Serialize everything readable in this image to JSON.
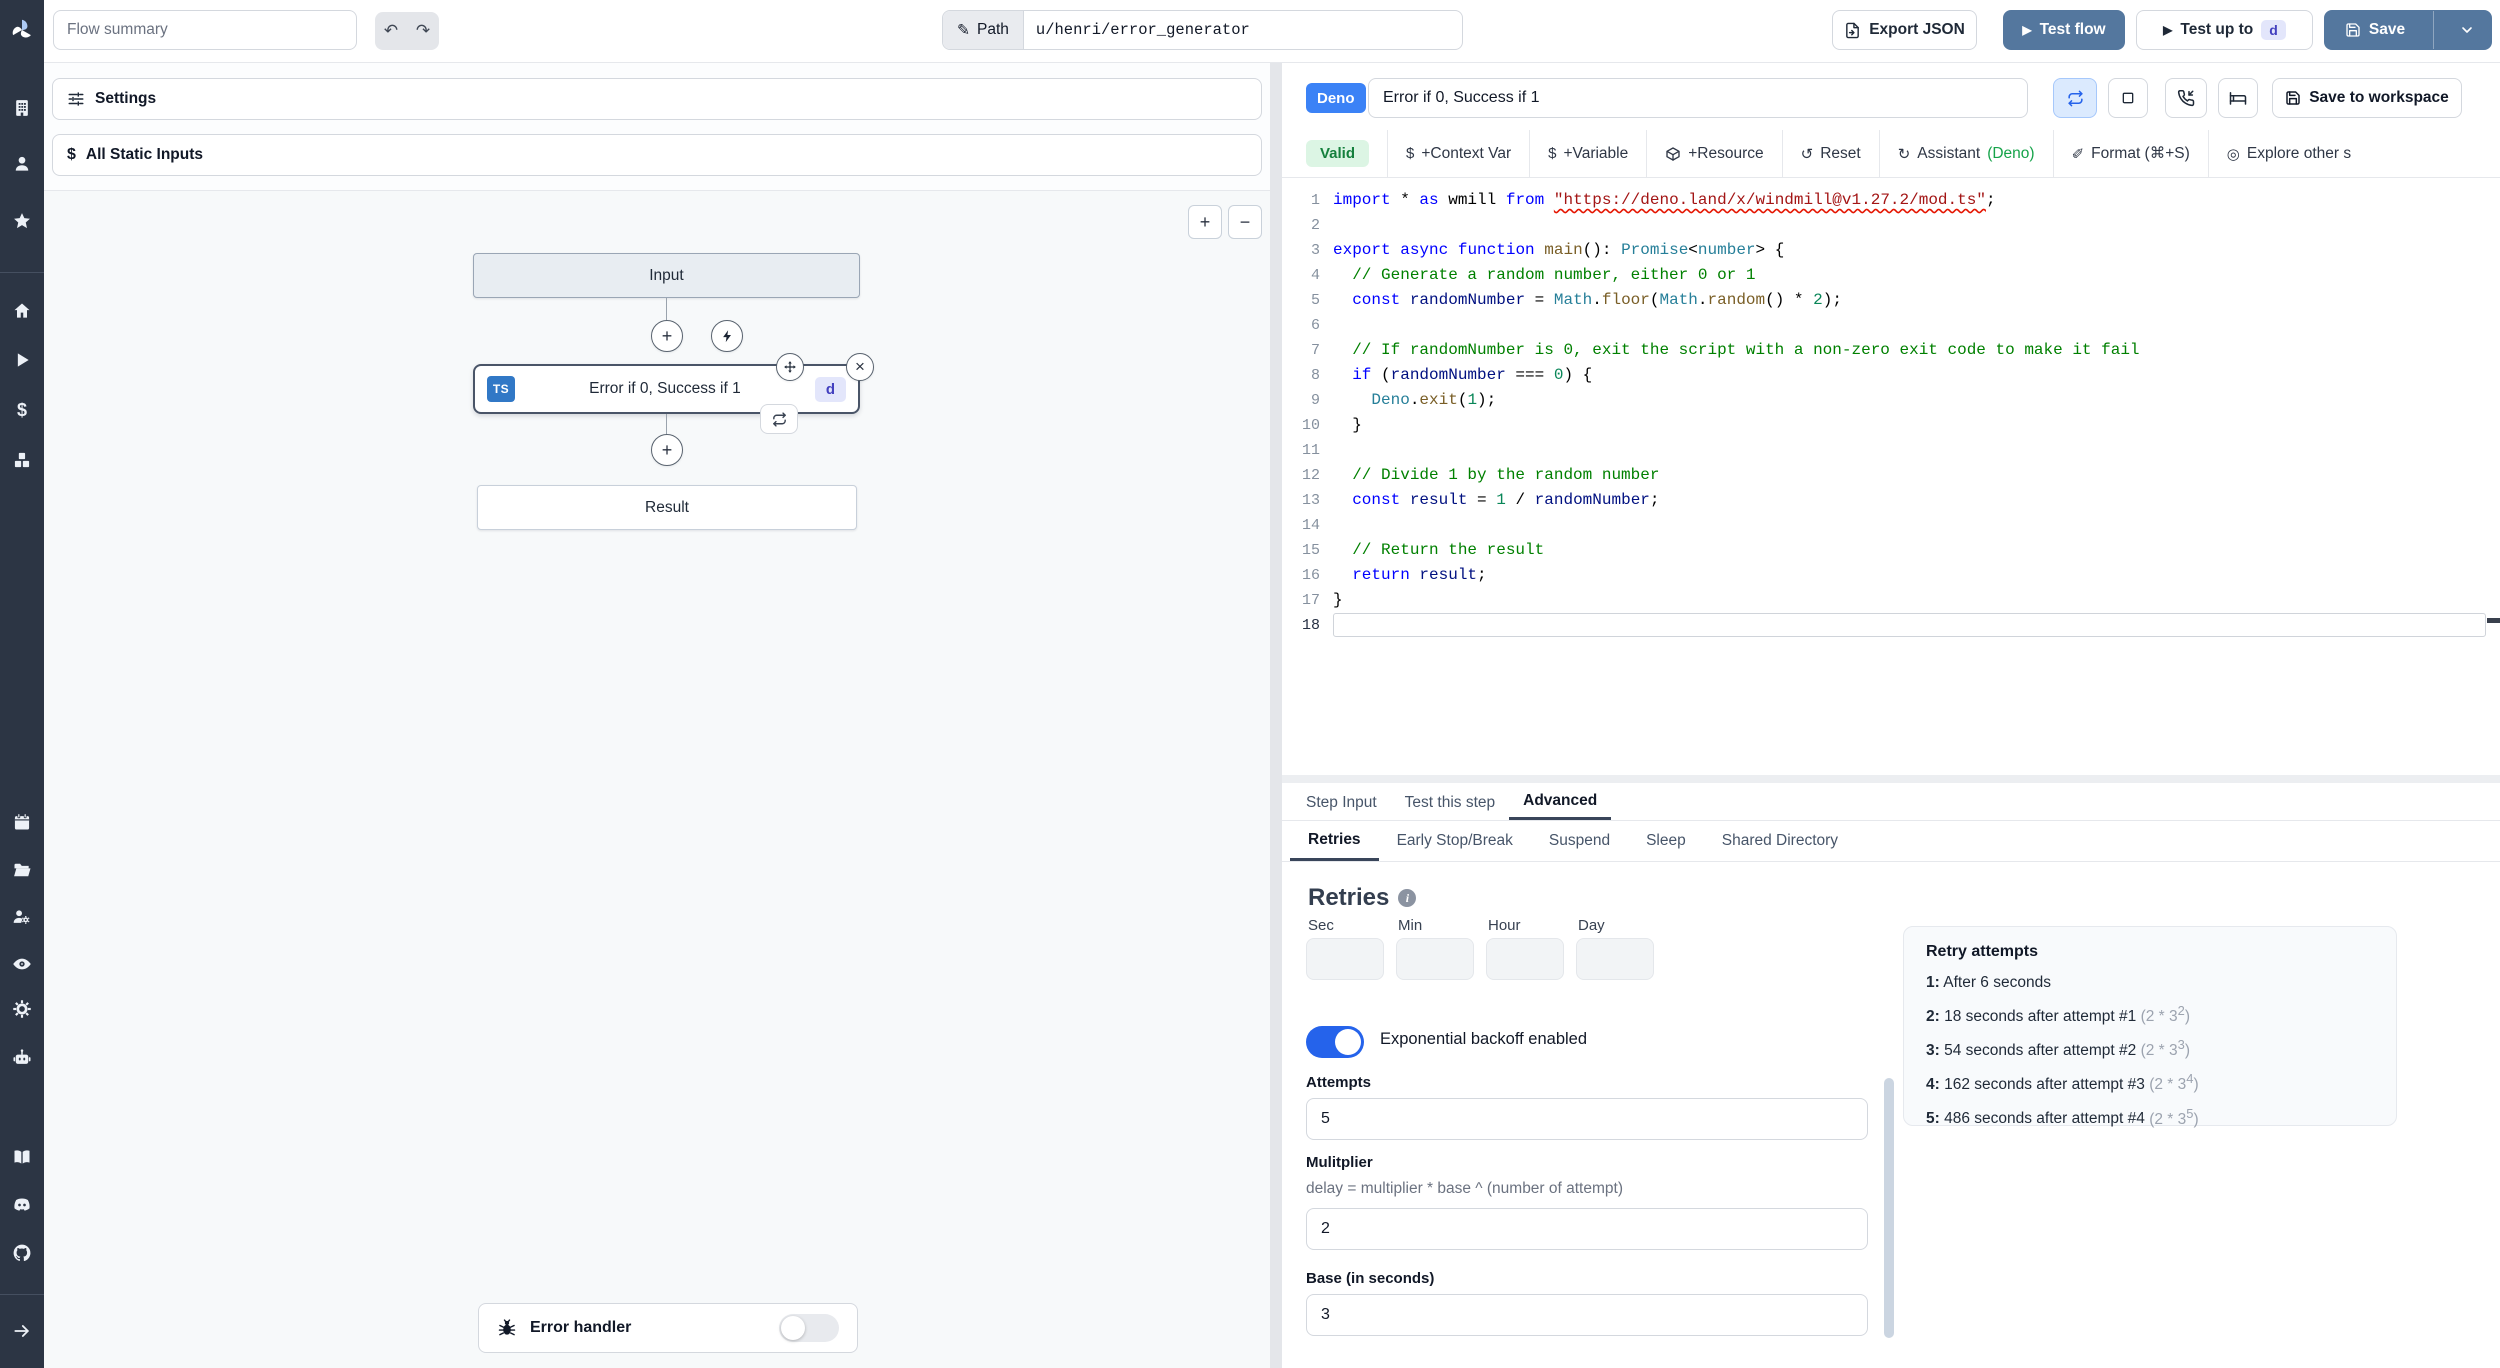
{
  "colors": {
    "primary_button": "#54779e",
    "deno_badge": "#3b82f6",
    "ts_badge": "#3178c6",
    "valid_green": "#15803d",
    "toggle_on": "#2563eb",
    "assistant_accent": "#16a34a",
    "squiggle_error": "#e51400",
    "sidebar_bg": "#2c3544"
  },
  "icons": {
    "undo": "↶",
    "redo": "↷",
    "pencil": "✎",
    "play": "▶",
    "plus": "+",
    "minus": "−",
    "close": "×",
    "dollar": "$",
    "reset": "↺",
    "assistant": "↻",
    "format": "✐",
    "explore": "◎",
    "info": "i"
  },
  "topbar": {
    "flow_summary_placeholder": "Flow summary",
    "path_label": "Path",
    "path_value": "u/henri/error_generator",
    "export_json": "Export JSON",
    "test_flow": "Test flow",
    "test_up_to": "Test up to",
    "test_up_to_badge": "d",
    "save": "Save"
  },
  "sidebar": {
    "icons": [
      "windmill-logo",
      "building",
      "user",
      "star",
      "home",
      "play",
      "dollar",
      "cubes",
      "calendar",
      "folder",
      "users-cog",
      "eye",
      "gear",
      "robot",
      "book",
      "discord",
      "github",
      "arrow-right"
    ]
  },
  "flow": {
    "settings": "Settings",
    "all_static_inputs": "All Static Inputs",
    "input_node": "Input",
    "step_node": {
      "lang": "TS",
      "title": "Error if 0, Success if 1",
      "badge": "d"
    },
    "result_node": "Result",
    "error_handler": "Error handler"
  },
  "editor": {
    "lang_badge": "Deno",
    "title_value": "Error if 0, Success if 1",
    "save_to_workspace": "Save to workspace",
    "toolbar": {
      "valid": "Valid",
      "context_var": "+Context Var",
      "variable": "+Variable",
      "resource": "+Resource",
      "reset": "Reset",
      "assistant": "Assistant",
      "assistant_lang": "(Deno)",
      "format": "Format (⌘+S)",
      "explore": "Explore other s"
    },
    "code": {
      "lines": [
        {
          "n": "1",
          "t": [
            [
              "kw",
              "import"
            ],
            [
              "pl",
              " * "
            ],
            [
              "kw",
              "as"
            ],
            [
              "pl",
              " wmill "
            ],
            [
              "kw",
              "from"
            ],
            [
              "pl",
              " "
            ],
            [
              "se",
              "\"https://deno.land/x/windmill@v1.27.2/mod.ts\""
            ],
            [
              "pl",
              ";"
            ]
          ]
        },
        {
          "n": "2",
          "t": []
        },
        {
          "n": "3",
          "t": [
            [
              "kw",
              "export"
            ],
            [
              "pl",
              " "
            ],
            [
              "kw",
              "async"
            ],
            [
              "pl",
              " "
            ],
            [
              "kw",
              "function"
            ],
            [
              "pl",
              " "
            ],
            [
              "fn",
              "main"
            ],
            [
              "pl",
              "(): "
            ],
            [
              "ty",
              "Promise"
            ],
            [
              "pl",
              "<"
            ],
            [
              "ty",
              "number"
            ],
            [
              "pl",
              "> {"
            ]
          ]
        },
        {
          "n": "4",
          "t": [
            [
              "cm",
              "  // Generate a random number, either 0 or 1"
            ]
          ]
        },
        {
          "n": "5",
          "t": [
            [
              "pl",
              "  "
            ],
            [
              "kw",
              "const"
            ],
            [
              "pl",
              " "
            ],
            [
              "vr",
              "randomNumber"
            ],
            [
              "pl",
              " = "
            ],
            [
              "ty",
              "Math"
            ],
            [
              "pl",
              "."
            ],
            [
              "fn",
              "floor"
            ],
            [
              "pl",
              "("
            ],
            [
              "ty",
              "Math"
            ],
            [
              "pl",
              "."
            ],
            [
              "fn",
              "random"
            ],
            [
              "pl",
              "() * "
            ],
            [
              "nu",
              "2"
            ],
            [
              "pl",
              ");"
            ]
          ]
        },
        {
          "n": "6",
          "t": []
        },
        {
          "n": "7",
          "t": [
            [
              "cm",
              "  // If randomNumber is 0, exit the script with a non-zero exit code to make it fail"
            ]
          ]
        },
        {
          "n": "8",
          "t": [
            [
              "pl",
              "  "
            ],
            [
              "kw",
              "if"
            ],
            [
              "pl",
              " ("
            ],
            [
              "vr",
              "randomNumber"
            ],
            [
              "pl",
              " === "
            ],
            [
              "nu",
              "0"
            ],
            [
              "pl",
              ") {"
            ]
          ]
        },
        {
          "n": "9",
          "t": [
            [
              "pl",
              "    "
            ],
            [
              "ty",
              "Deno"
            ],
            [
              "pl",
              "."
            ],
            [
              "fn",
              "exit"
            ],
            [
              "pl",
              "("
            ],
            [
              "nu",
              "1"
            ],
            [
              "pl",
              ");"
            ]
          ]
        },
        {
          "n": "10",
          "t": [
            [
              "pl",
              "  }"
            ]
          ]
        },
        {
          "n": "11",
          "t": []
        },
        {
          "n": "12",
          "t": [
            [
              "cm",
              "  // Divide 1 by the random number"
            ]
          ]
        },
        {
          "n": "13",
          "t": [
            [
              "pl",
              "  "
            ],
            [
              "kw",
              "const"
            ],
            [
              "pl",
              " "
            ],
            [
              "vr",
              "result"
            ],
            [
              "pl",
              " = "
            ],
            [
              "nu",
              "1"
            ],
            [
              "pl",
              " / "
            ],
            [
              "vr",
              "randomNumber"
            ],
            [
              "pl",
              ";"
            ]
          ]
        },
        {
          "n": "14",
          "t": []
        },
        {
          "n": "15",
          "t": [
            [
              "cm",
              "  // Return the result"
            ]
          ]
        },
        {
          "n": "16",
          "t": [
            [
              "pl",
              "  "
            ],
            [
              "kw",
              "return"
            ],
            [
              "pl",
              " "
            ],
            [
              "vr",
              "result"
            ],
            [
              "pl",
              ";"
            ]
          ]
        },
        {
          "n": "17",
          "t": [
            [
              "pl",
              "}"
            ]
          ]
        },
        {
          "n": "18",
          "t": [],
          "cur": true
        }
      ]
    }
  },
  "tabs": {
    "step_input": "Step Input",
    "test_this_step": "Test this step",
    "advanced": "Advanced"
  },
  "subtabs": {
    "retries": "Retries",
    "early_stop": "Early Stop/Break",
    "suspend": "Suspend",
    "sleep": "Sleep",
    "shared_directory": "Shared Directory"
  },
  "advanced": {
    "retries": {
      "heading": "Retries",
      "units": [
        "Sec",
        "Min",
        "Hour",
        "Day"
      ],
      "exp_backoff_label": "Exponential backoff enabled",
      "attempts_label": "Attempts",
      "attempts_value": "5",
      "multiplier_label": "Mulitplier",
      "multiplier_help": "delay = multiplier * base ^ (number of attempt)",
      "multiplier_value": "2",
      "base_label": "Base (in seconds)",
      "base_value": "3"
    },
    "retry_attempts": {
      "title": "Retry attempts",
      "rows": [
        {
          "num": "1:",
          "text": "After 6 seconds"
        },
        {
          "num": "2:",
          "text": "18 seconds after attempt #1",
          "formula_prefix": "(2 * 3",
          "formula_sup": "2",
          "formula_suffix": ")"
        },
        {
          "num": "3:",
          "text": "54 seconds after attempt #2",
          "formula_prefix": "(2 * 3",
          "formula_sup": "3",
          "formula_suffix": ")"
        },
        {
          "num": "4:",
          "text": "162 seconds after attempt #3",
          "formula_prefix": "(2 * 3",
          "formula_sup": "4",
          "formula_suffix": ")"
        },
        {
          "num": "5:",
          "text": "486 seconds after attempt #4",
          "formula_prefix": "(2 * 3",
          "formula_sup": "5",
          "formula_suffix": ")"
        }
      ]
    }
  }
}
